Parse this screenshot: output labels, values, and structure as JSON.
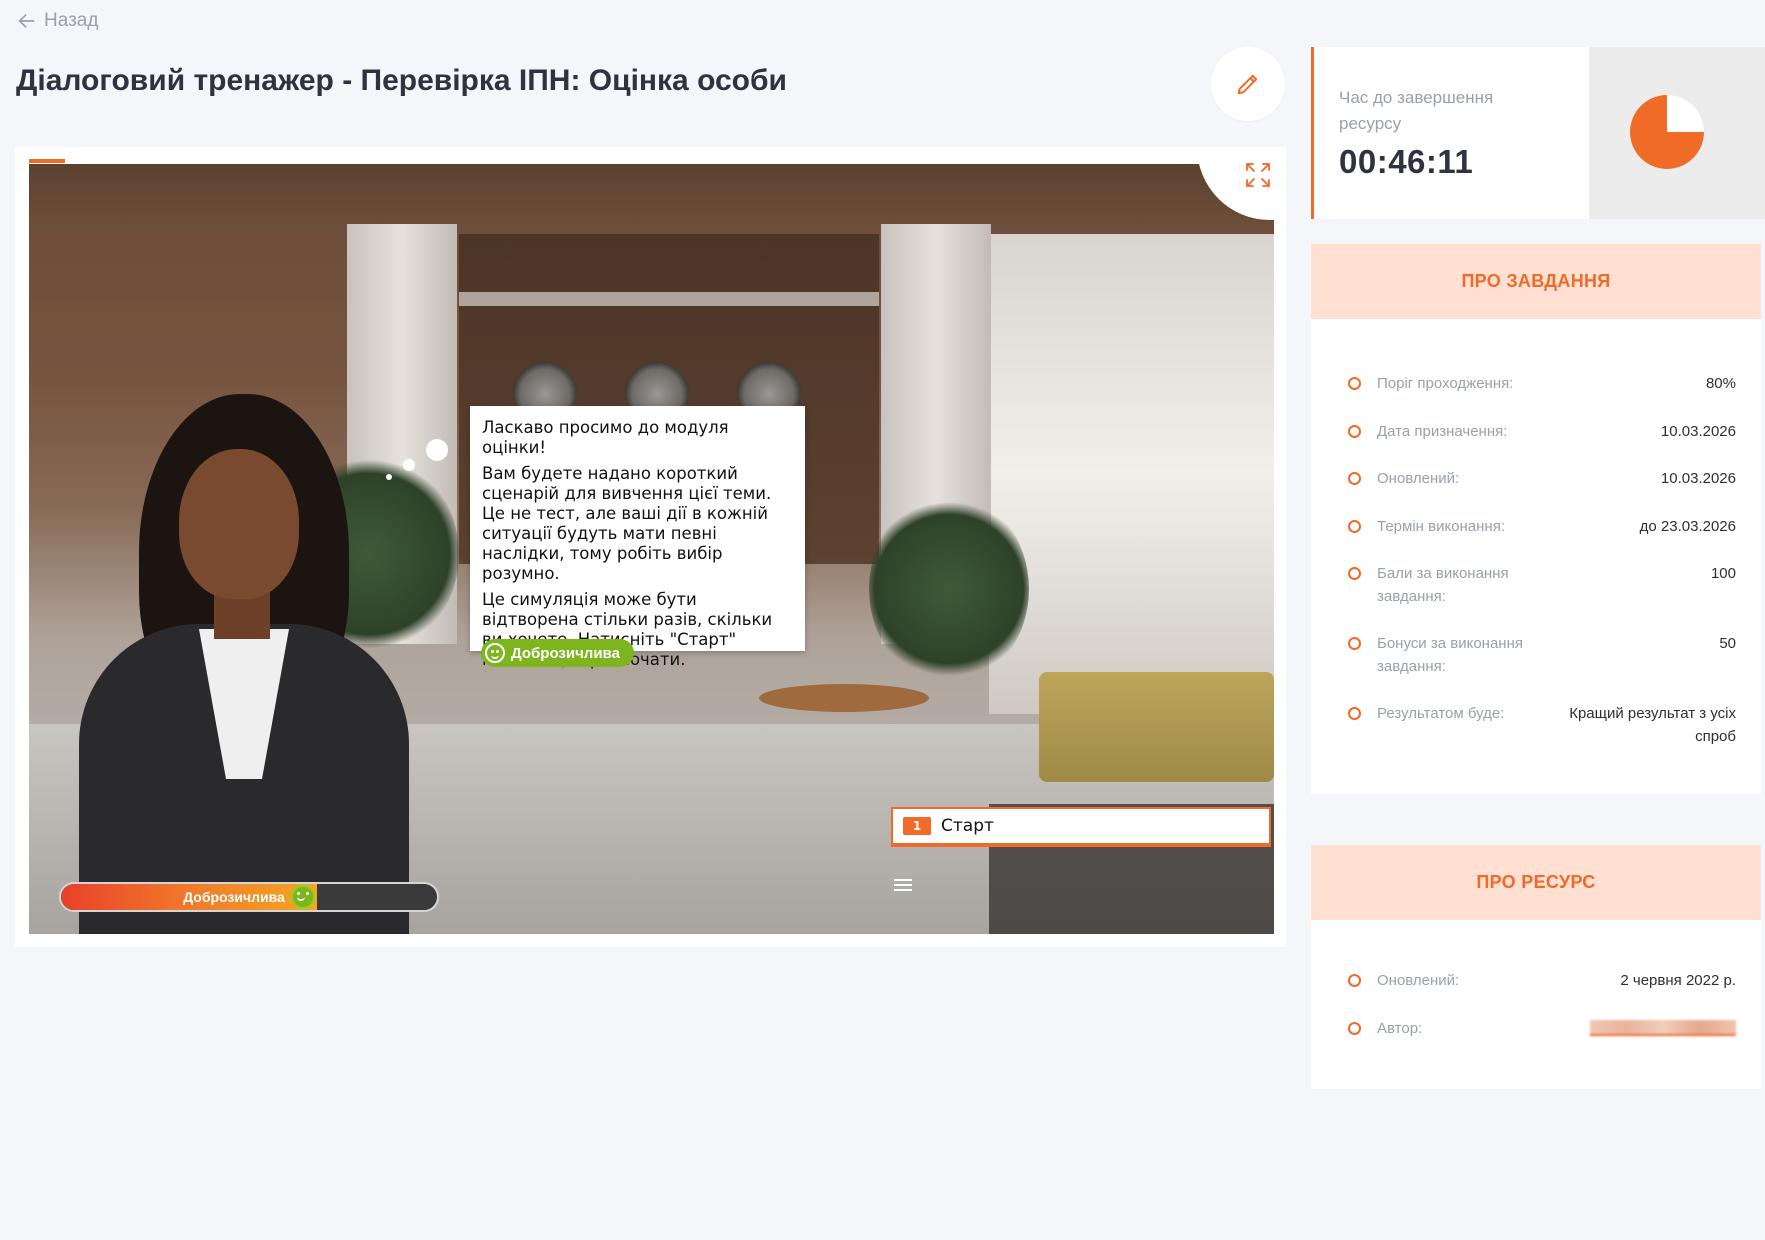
{
  "back": {
    "label": "Назад"
  },
  "title": "Діалоговий тренажер - Перевірка ІПН: Оцінка особи",
  "player": {
    "bubble": {
      "greeting": "Ласкаво просимо до модуля оцінки!",
      "paragraph1": "Вам будете надано короткий сценарій для вивчення цієї теми. Це не тест, але ваші дії в кожній ситуації будуть мати певні наслідки, тому робіть вибір розумно.",
      "paragraph2": "Це симуляція може бути відтворена стільки разів, скільки ви хочете. Натисніть \"Старт\" нижче, щоб розпочати."
    },
    "mood_label": "Доброзичлива",
    "mood_bar_label": "Доброзичлива",
    "mood_level_percent": 68,
    "option": {
      "number": "1",
      "label": "Старт"
    }
  },
  "timer": {
    "label": "Час до завершення ресурсу",
    "value": "00:46:11",
    "remaining_fraction": 0.75
  },
  "task": {
    "header": "ПРО ЗАВДАННЯ",
    "rows": [
      {
        "label": "Поріг проходження:",
        "value": "80%"
      },
      {
        "label": "Дата призначення:",
        "value": "10.03.2026"
      },
      {
        "label": "Оновлений:",
        "value": "10.03.2026"
      },
      {
        "label": "Термін виконання:",
        "value": "до 23.03.2026"
      },
      {
        "label": "Бали за виконання завдання:",
        "value": "100"
      },
      {
        "label": "Бонуси за виконання завдання:",
        "value": "50"
      },
      {
        "label": "Результатом буде:",
        "value": "Кращий результат з усіх спроб"
      }
    ]
  },
  "resource": {
    "header": "ПРО РЕСУРС",
    "rows": [
      {
        "label": "Оновлений:",
        "value": "2 червня 2022 р."
      },
      {
        "label": "Автор:",
        "value": ""
      }
    ]
  },
  "colors": {
    "accent": "#f06a28",
    "accent_light": "#ffe0d2",
    "mood_green": "#7db51f"
  },
  "icons": {
    "back": "arrow-left-icon",
    "edit": "pencil-icon",
    "fullscreen": "expand-icon",
    "menu": "hamburger-icon",
    "mood": "smiley-icon"
  }
}
